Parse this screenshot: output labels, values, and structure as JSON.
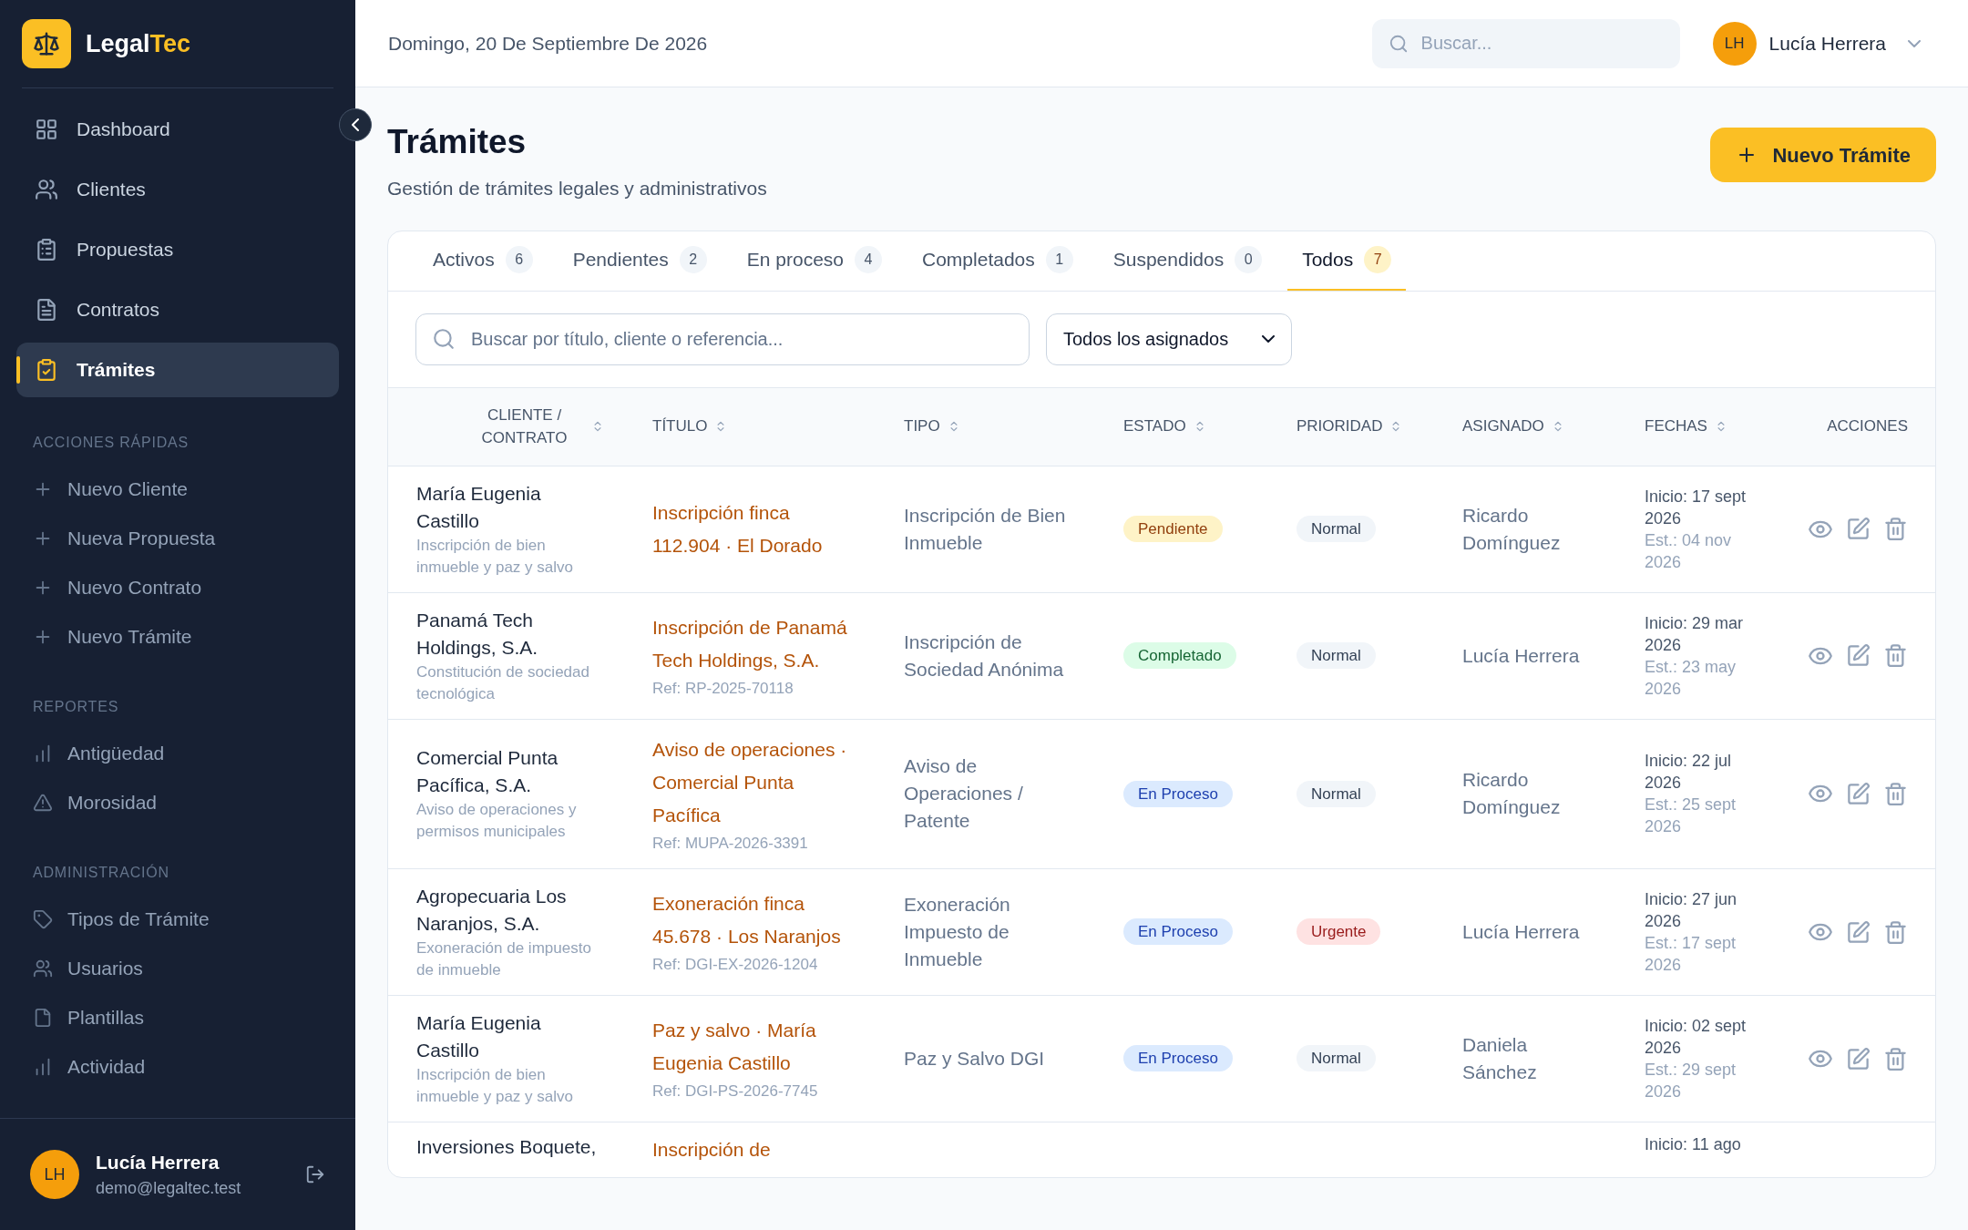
{
  "brand": {
    "name_1": "Legal",
    "name_2": "Tec"
  },
  "sidebar": {
    "items": [
      {
        "label": "Dashboard",
        "selected": false
      },
      {
        "label": "Clientes",
        "selected": false
      },
      {
        "label": "Propuestas",
        "selected": false
      },
      {
        "label": "Contratos",
        "selected": false
      },
      {
        "label": "Trámites",
        "selected": true
      }
    ],
    "sections": [
      {
        "title": "ACCIONES RÁPIDAS",
        "items": [
          "Nuevo Cliente",
          "Nueva Propuesta",
          "Nuevo Contrato",
          "Nuevo Trámite"
        ]
      },
      {
        "title": "REPORTES",
        "items": [
          "Antigüedad",
          "Morosidad"
        ]
      },
      {
        "title": "ADMINISTRACIÓN",
        "items": [
          "Tipos de Trámite",
          "Usuarios",
          "Plantillas",
          "Actividad"
        ]
      }
    ],
    "user": {
      "initials": "LH",
      "name": "Lucía Herrera",
      "email": "demo@legaltec.test"
    }
  },
  "topbar": {
    "date": "Domingo, 20 De Septiembre De 2026",
    "search": {
      "placeholder": "Buscar..."
    },
    "user": {
      "initials": "LH",
      "name": "Lucía Herrera"
    }
  },
  "page": {
    "title": "Trámites",
    "subtitle": "Gestión de trámites legales y administrativos",
    "primary_button": "Nuevo Trámite"
  },
  "tabs": [
    {
      "label": "Activos",
      "count": "6",
      "selected": false
    },
    {
      "label": "Pendientes",
      "count": "2",
      "selected": false
    },
    {
      "label": "En proceso",
      "count": "4",
      "selected": false
    },
    {
      "label": "Completados",
      "count": "1",
      "selected": false
    },
    {
      "label": "Suspendidos",
      "count": "0",
      "selected": false
    },
    {
      "label": "Todos",
      "count": "7",
      "selected": true
    }
  ],
  "filters": {
    "search": {
      "placeholder": "Buscar por título, cliente o referencia..."
    },
    "assignee": "Todos los asignados"
  },
  "table": {
    "columns": [
      {
        "label": "CLIENTE / CONTRATO",
        "sortable": true
      },
      {
        "label": "TÍTULO",
        "sortable": true
      },
      {
        "label": "TIPO",
        "sortable": true
      },
      {
        "label": "ESTADO",
        "sortable": true
      },
      {
        "label": "PRIORIDAD",
        "sortable": true
      },
      {
        "label": "ASIGNADO",
        "sortable": true
      },
      {
        "label": "FECHAS",
        "sortable": true
      },
      {
        "label": "ACCIONES",
        "sortable": false
      }
    ],
    "rows": [
      {
        "client": "María Eugenia Castillo",
        "description": "Inscripción de bien inmueble y paz y salvo",
        "title": "Inscripción finca 112.904 · El Dorado",
        "type": "Inscripción de Bien Inmueble",
        "status": {
          "label": "Pendiente",
          "kind": "pending"
        },
        "priority": {
          "label": "Normal",
          "kind": "normal"
        },
        "assignee": "Ricardo Domínguez",
        "start": "Inicio: 17 sept 2026",
        "estimate": "Est.: 04 nov 2026"
      },
      {
        "client": "Panamá Tech Holdings, S.A.",
        "description": "Constitución de sociedad tecnológica",
        "title": "Inscripción de Panamá Tech Holdings, S.A.",
        "ref": "Ref: RP-2025-70118",
        "type": "Inscripción de Sociedad Anónima",
        "status": {
          "label": "Completado",
          "kind": "done"
        },
        "priority": {
          "label": "Normal",
          "kind": "normal"
        },
        "assignee": "Lucía Herrera",
        "start": "Inicio: 29 mar 2026",
        "estimate": "Est.: 23 may 2026"
      },
      {
        "client": "Comercial Punta Pacífica, S.A.",
        "description": "Aviso de operaciones y permisos municipales",
        "title": "Aviso de operaciones · Comercial Punta Pacífica",
        "ref": "Ref: MUPA-2026-3391",
        "type": "Aviso de Operaciones / Patente",
        "status": {
          "label": "En Proceso",
          "kind": "progress"
        },
        "priority": {
          "label": "Normal",
          "kind": "normal"
        },
        "assignee": "Ricardo Domínguez",
        "start": "Inicio: 22 jul 2026",
        "estimate": "Est.: 25 sept 2026"
      },
      {
        "client": "Agropecuaria Los Naranjos, S.A.",
        "description": "Exoneración de impuesto de inmueble",
        "title": "Exoneración finca 45.678 · Los Naranjos",
        "ref": "Ref: DGI-EX-2026-1204",
        "type": "Exoneración Impuesto de Inmueble",
        "status": {
          "label": "En Proceso",
          "kind": "progress"
        },
        "priority": {
          "label": "Urgente",
          "kind": "urgent"
        },
        "assignee": "Lucía Herrera",
        "start": "Inicio: 27 jun 2026",
        "estimate": "Est.: 17 sept 2026"
      },
      {
        "client": "María Eugenia Castillo",
        "description": "Inscripción de bien inmueble y paz y salvo",
        "title": "Paz y salvo · María Eugenia Castillo",
        "ref": "Ref: DGI-PS-2026-7745",
        "type": "Paz y Salvo DGI",
        "status": {
          "label": "En Proceso",
          "kind": "progress"
        },
        "priority": {
          "label": "Normal",
          "kind": "normal"
        },
        "assignee": "Daniela Sánchez",
        "start": "Inicio: 02 sept 2026",
        "estimate": "Est.: 29 sept 2026"
      },
      {
        "client": "Inversiones Boquete,",
        "title": "Inscripción de",
        "start": "Inicio: 11 ago"
      }
    ]
  }
}
